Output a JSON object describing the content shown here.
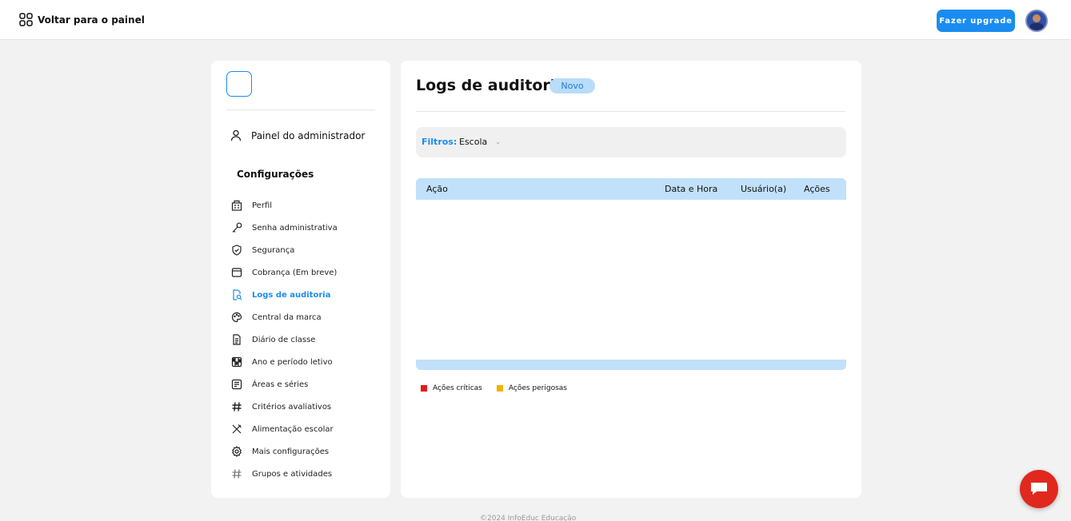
{
  "header": {
    "back_label": "Voltar para o painel",
    "upgrade_label": "Fazer upgrade"
  },
  "sidebar": {
    "admin_label": "Painel do administrador",
    "config_title": "Configurações",
    "items": [
      {
        "label": "Perfil",
        "icon": "building-icon"
      },
      {
        "label": "Senha administrativa",
        "icon": "key-icon"
      },
      {
        "label": "Segurança",
        "icon": "shield-icon"
      },
      {
        "label": "Cobrança (Em breve)",
        "icon": "window-icon"
      },
      {
        "label": "Logs de auditoria",
        "icon": "audit-file-icon",
        "active": true
      },
      {
        "label": "Central da marca",
        "icon": "palette-icon"
      },
      {
        "label": "Diário de classe",
        "icon": "document-icon"
      },
      {
        "label": "Ano e período letivo",
        "icon": "calendar-icon"
      },
      {
        "label": "Áreas e séries",
        "icon": "list-icon"
      },
      {
        "label": "Critérios avaliativos",
        "icon": "hash-icon"
      },
      {
        "label": "Alimentação escolar",
        "icon": "cutlery-icon"
      },
      {
        "label": "Mais configurações",
        "icon": "gear-icon"
      },
      {
        "label": "Grupos e atividades",
        "icon": "hash-icon"
      }
    ]
  },
  "main": {
    "title": "Logs de auditoria",
    "badge": "Novo",
    "filters_label": "Filtros:",
    "filter_value": "Escola",
    "columns": [
      "Ação",
      "Data e Hora",
      "Usuário(a)",
      "Ações"
    ],
    "legend": [
      {
        "label": "Ações críticas",
        "color": "#e31b1b"
      },
      {
        "label": "Ações perigosas",
        "color": "#f0b400"
      }
    ]
  },
  "footer": {
    "text": "©2024 InfoEduc Educação"
  },
  "colors": {
    "accent": "#1a8cf0",
    "table_header": "#c1e0f9",
    "chat": "#e0281e"
  }
}
